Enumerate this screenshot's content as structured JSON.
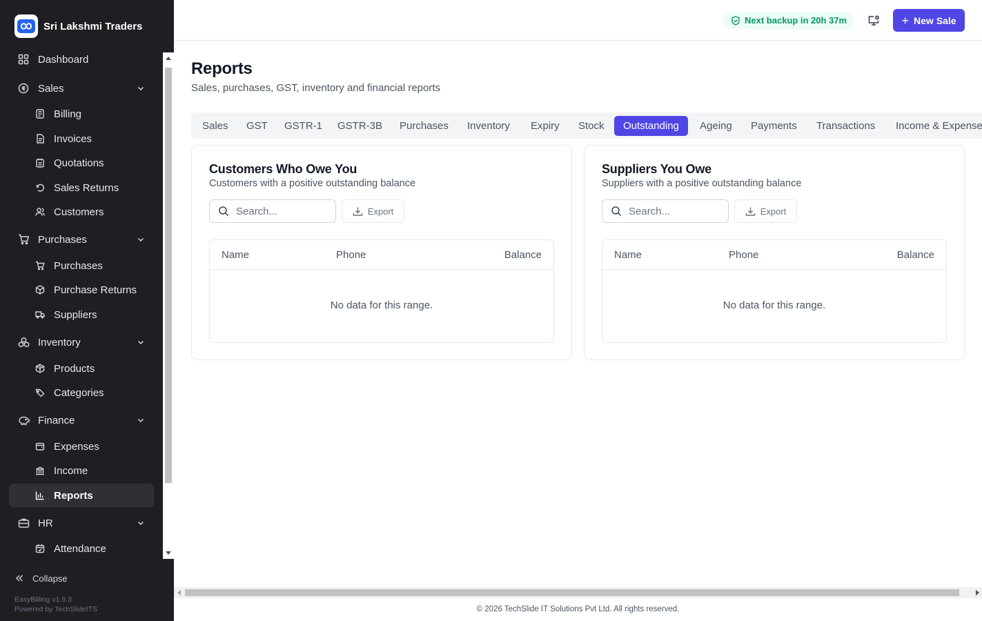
{
  "brand": {
    "name": "Sri Lakshmi Traders"
  },
  "sidebar": {
    "items": [
      {
        "label": "Dashboard",
        "icon": "dashboard-icon"
      },
      {
        "label": "Sales",
        "icon": "sales-icon"
      },
      {
        "label": "Billing",
        "icon": "billing-icon"
      },
      {
        "label": "Invoices",
        "icon": "invoice-icon"
      },
      {
        "label": "Quotations",
        "icon": "quotation-icon"
      },
      {
        "label": "Sales Returns",
        "icon": "return-icon"
      },
      {
        "label": "Customers",
        "icon": "customers-icon"
      },
      {
        "label": "Purchases",
        "icon": "cart-icon"
      },
      {
        "label": "Purchases",
        "icon": "cart-icon"
      },
      {
        "label": "Purchase Returns",
        "icon": "purchase-return-icon"
      },
      {
        "label": "Suppliers",
        "icon": "truck-icon"
      },
      {
        "label": "Inventory",
        "icon": "boxes-icon"
      },
      {
        "label": "Products",
        "icon": "package-icon"
      },
      {
        "label": "Categories",
        "icon": "tag-icon"
      },
      {
        "label": "Finance",
        "icon": "finance-icon"
      },
      {
        "label": "Expenses",
        "icon": "wallet-icon"
      },
      {
        "label": "Income",
        "icon": "bank-icon"
      },
      {
        "label": "Reports",
        "icon": "bar-chart-icon"
      },
      {
        "label": "HR",
        "icon": "briefcase-icon"
      },
      {
        "label": "Attendance",
        "icon": "calendar-icon"
      }
    ],
    "collapse_label": "Collapse",
    "version": "EasyBilling v1.9.3",
    "powered_by": "Powered by TechSlideITS"
  },
  "topbar": {
    "backup_text": "Next backup in 20h 37m",
    "new_sale_label": "New Sale"
  },
  "page": {
    "title": "Reports",
    "subtitle": "Sales, purchases, GST, inventory and financial reports"
  },
  "tabs": [
    {
      "label": "Sales"
    },
    {
      "label": "GST"
    },
    {
      "label": "GSTR-1"
    },
    {
      "label": "GSTR-3B"
    },
    {
      "label": "Purchases"
    },
    {
      "label": "Inventory"
    },
    {
      "label": "Expiry"
    },
    {
      "label": "Stock"
    },
    {
      "label": "Outstanding"
    },
    {
      "label": "Ageing"
    },
    {
      "label": "Payments"
    },
    {
      "label": "Transactions"
    },
    {
      "label": "Income & Expense"
    }
  ],
  "active_tab": "Outstanding",
  "cards": [
    {
      "title": "Customers Who Owe You",
      "subtitle": "Customers with a positive outstanding balance",
      "search_placeholder": "Search...",
      "export_label": "Export",
      "columns": [
        "Name",
        "Phone",
        "Balance"
      ],
      "empty_text": "No data for this range."
    },
    {
      "title": "Suppliers You Owe",
      "subtitle": "Suppliers with a positive outstanding balance",
      "search_placeholder": "Search...",
      "export_label": "Export",
      "columns": [
        "Name",
        "Phone",
        "Balance"
      ],
      "empty_text": "No data for this range."
    }
  ],
  "footer": {
    "text": "© 2026 TechSlide IT Solutions Pvt Ltd. All rights reserved."
  },
  "colors": {
    "accent": "#4f46e5",
    "sidebar_bg": "#1f1f23",
    "success": "#059669"
  }
}
